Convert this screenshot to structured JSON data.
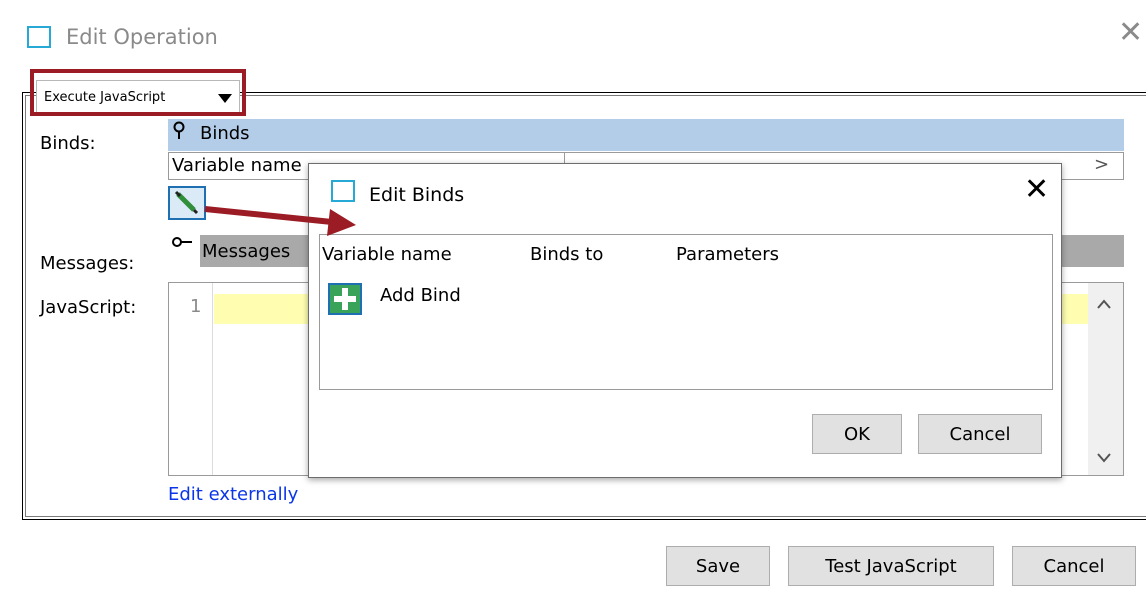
{
  "window": {
    "title": "Edit Operation",
    "close_glyph": "✕",
    "accent_color": "#27a9d6"
  },
  "operation": {
    "selected_type": "Execute JavaScript",
    "highlight_color": "#9b1c24"
  },
  "fields": {
    "binds_label": "Binds:",
    "messages_label": "Messages:",
    "javascript_label": "JavaScript:"
  },
  "binds_panel": {
    "header": "Binds",
    "columns": [
      "Variable name",
      "Binds to"
    ],
    "chevron": ">"
  },
  "messages_panel": {
    "header": "Messages"
  },
  "editor": {
    "line_number": "1",
    "scroll_up": "⌃",
    "scroll_down": "⌄",
    "edit_externally": "Edit externally"
  },
  "buttons": {
    "save": "Save",
    "test": "Test JavaScript",
    "cancel": "Cancel"
  },
  "modal": {
    "title": "Edit Binds",
    "close_glyph": "✕",
    "columns": [
      "Variable name",
      "Binds to",
      "Parameters"
    ],
    "add_bind": "Add Bind",
    "ok": "OK",
    "cancel": "Cancel"
  },
  "icons": {
    "window": "window-icon",
    "pin": "pin-icon",
    "pencil": "pencil-icon",
    "add": "add-icon"
  }
}
